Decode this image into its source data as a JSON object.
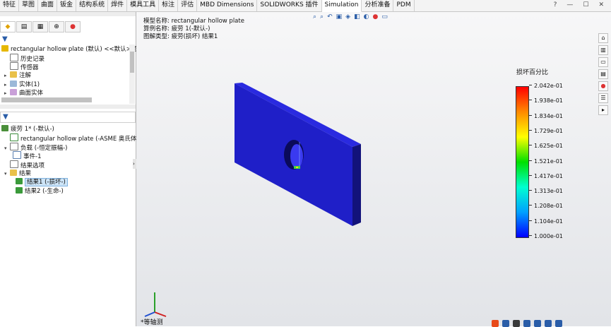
{
  "tabs": [
    "特征",
    "草图",
    "曲面",
    "钣金",
    "结构系统",
    "焊件",
    "模具工具",
    "标注",
    "评估",
    "MBD Dimensions",
    "SOLIDWORKS 插件",
    "Simulation",
    "分析准备",
    "PDM"
  ],
  "active_tab": "Simulation",
  "window_controls": {
    "help": "?",
    "minimize": "—",
    "restore": "☐",
    "close": "✕"
  },
  "top_tree": {
    "root": "rectangular hollow plate (默认) <<默认>_显示",
    "items": [
      "历史记录",
      "传感器",
      "注解",
      "实体(1)",
      "曲面实体"
    ]
  },
  "study_tree": {
    "study": "疲劳 1* (-默认-)",
    "part": "rectangular hollow plate (-ASME 奥氏体钢-)",
    "loads": "负载 (-恒定振幅-)",
    "event": "事件-1",
    "result_options": "结果选项",
    "results": "结果",
    "result1": "结果1 (-损坏-)",
    "result2": "结果2 (-生命-)"
  },
  "viewport": {
    "model_name": "模型名称: rectangular hollow plate",
    "study_name": "算例名称: 疲劳 1(-默认-)",
    "plot_type": "图解类型: 疲劳(损坏) 结果1",
    "view_label": "*等轴测"
  },
  "legend": {
    "title": "损坏百分比",
    "ticks": [
      "2.042e-01",
      "1.938e-01",
      "1.834e-01",
      "1.729e-01",
      "1.625e-01",
      "1.521e-01",
      "1.417e-01",
      "1.313e-01",
      "1.208e-01",
      "1.104e-01",
      "1.000e-01"
    ]
  },
  "icons": {
    "filter": "filter-icon",
    "colors": {
      "plate_face": "#1f1fc8",
      "plate_top": "#2a2ae0",
      "plate_side": "#12127a",
      "accent": "#2a5da8"
    }
  }
}
